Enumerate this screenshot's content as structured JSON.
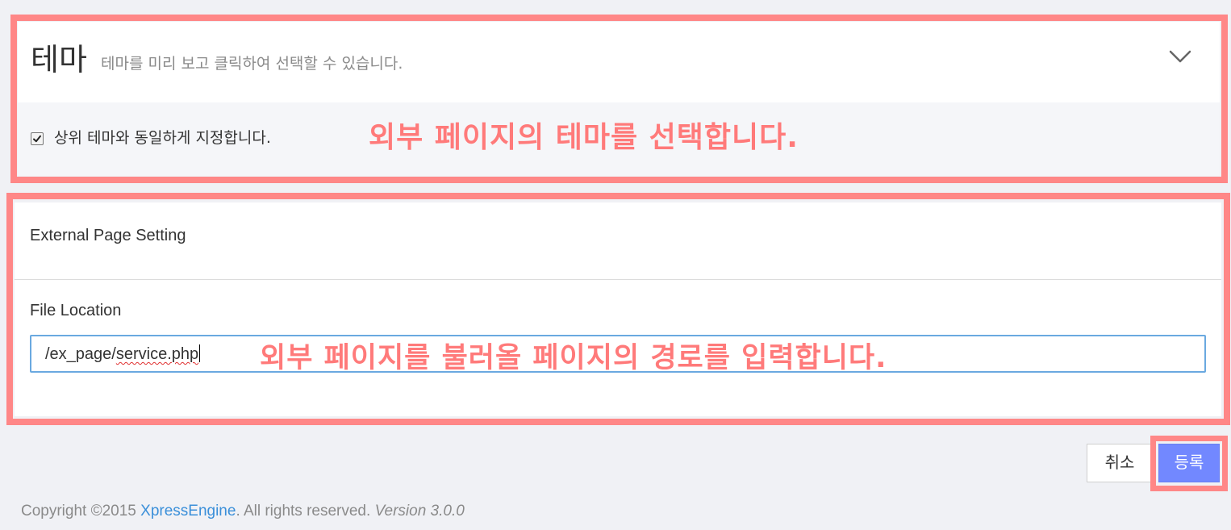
{
  "theme_panel": {
    "title": "테마",
    "description": "테마를 미리 보고 클릭하여 선택할 수 있습니다.",
    "inherit_checkbox": {
      "label": "상위 테마와 동일하게 지정합니다.",
      "checked": true
    },
    "collapse_icon": "chevron-down-icon"
  },
  "external_page": {
    "heading": "External Page Setting",
    "file_location": {
      "label": "File Location",
      "value_prefix": "/ex_page/",
      "value_misspelled": "service.php"
    }
  },
  "annotations": {
    "theme_note": "외부 페이지의 테마를 선택합니다.",
    "path_note": "외부 페이지를 불러올 페이지의 경로를 입력합니다.",
    "color": "#ff8787"
  },
  "actions": {
    "cancel_label": "취소",
    "submit_label": "등록"
  },
  "footer": {
    "copyright": "Copyright ©2015 ",
    "brand": "XpressEngine",
    "rights": ". All rights reserved. ",
    "version": "Version 3.0.0"
  },
  "colors": {
    "background": "#f0f1f5",
    "submit_button": "#7288ff",
    "input_border_focus": "#6aa9e0",
    "brand_link": "#3a8fd9"
  }
}
